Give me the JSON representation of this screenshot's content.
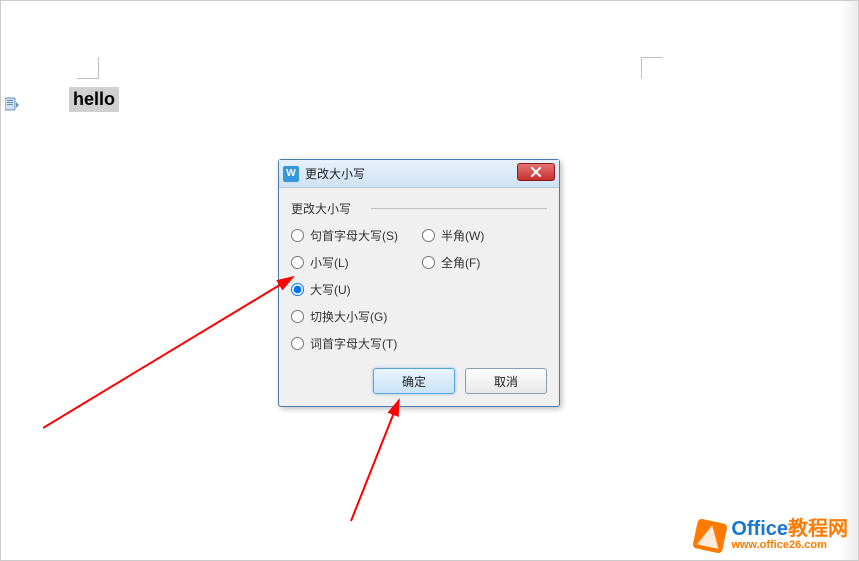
{
  "document": {
    "selected_text": "hello"
  },
  "dialog": {
    "title": "更改大小写",
    "legend": "更改大小写",
    "options": {
      "left": [
        {
          "label": "句首字母大写(S)",
          "selected": false
        },
        {
          "label": "小写(L)",
          "selected": false
        },
        {
          "label": "大写(U)",
          "selected": true
        },
        {
          "label": "切换大小写(G)",
          "selected": false
        },
        {
          "label": "词首字母大写(T)",
          "selected": false
        }
      ],
      "right": [
        {
          "label": "半角(W)",
          "selected": false
        },
        {
          "label": "全角(F)",
          "selected": false
        }
      ]
    },
    "buttons": {
      "ok": "确定",
      "cancel": "取消"
    }
  },
  "watermark": {
    "brand_prefix": "Office",
    "brand_suffix": "教程网",
    "url": "www.office26.com"
  },
  "icons": {
    "app_letter": "W"
  }
}
